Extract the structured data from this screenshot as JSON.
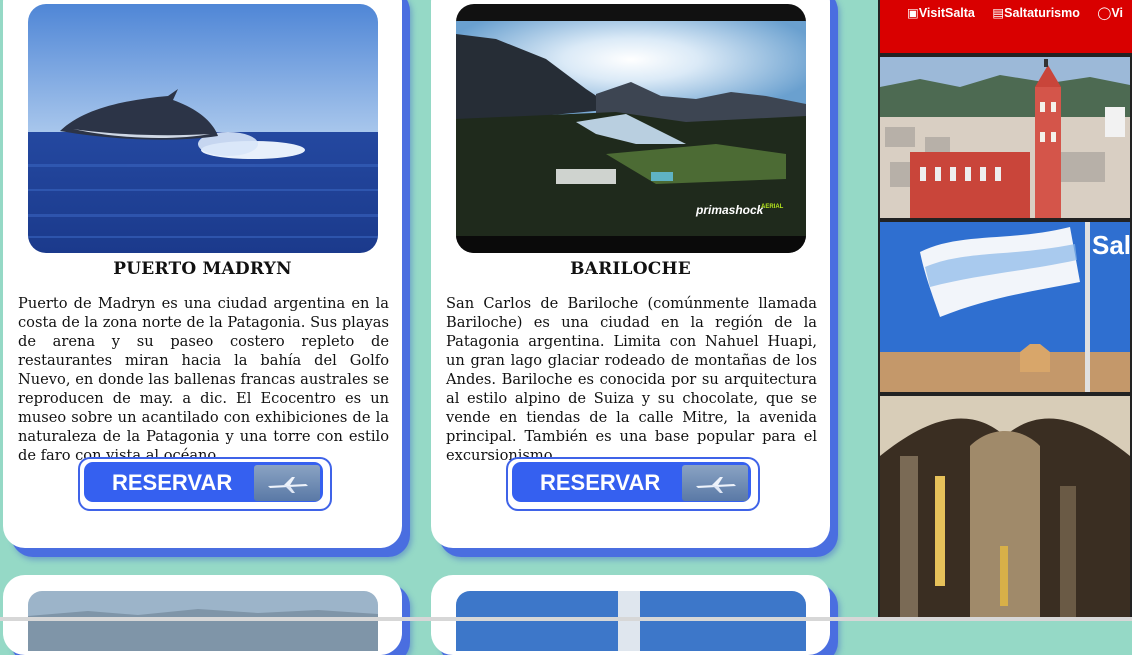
{
  "cards": [
    {
      "city": "PUERTO MADRYN",
      "description": "Puerto de Madryn es una ciudad argentina en la costa de la zona norte de la Patagonia. Sus playas de arena y su paseo costero repleto de restaurantes miran hacia la bahía del Golfo Nuevo, en donde las ballenas francas australes se reproducen de may. a dic. El Ecocentro es un museo sobre un acantilado con exhibiciones de la naturaleza de la Patagonia y una torre con estilo de faro con vista al océano.",
      "button_label": "RESERVAR",
      "icon": "whale-photo"
    },
    {
      "city": "BARILOCHE",
      "description": "San Carlos de Bariloche (comúnmente llamada Bariloche) es una ciudad en la región de la Patagonia argentina. Limita con Nahuel Huapi, un gran lago glaciar rodeado de montañas de los Andes. Bariloche es conocida por su arquitectura al estilo alpino de Suiza y su chocolate, que se vende en tiendas de la calle Mitre, la avenida principal. También es una base popular para el excursionismo.",
      "button_label": "RESERVAR",
      "watermark": "primashock",
      "watermark_tag": "AERIAL",
      "icon": "lake-photo"
    }
  ],
  "sidebar": {
    "social_links": [
      "VisitSalta",
      "Saltaturismo",
      "Vi"
    ],
    "images": [
      "salta-cathedral-photo",
      "argentina-flag-photo",
      "church-interior-photo"
    ],
    "overlay_text": "Sal"
  },
  "colors": {
    "background": "#95d9c6",
    "button": "#3560f0",
    "card_shadow": "#4a6ee0",
    "social_bar": "#d90000"
  }
}
